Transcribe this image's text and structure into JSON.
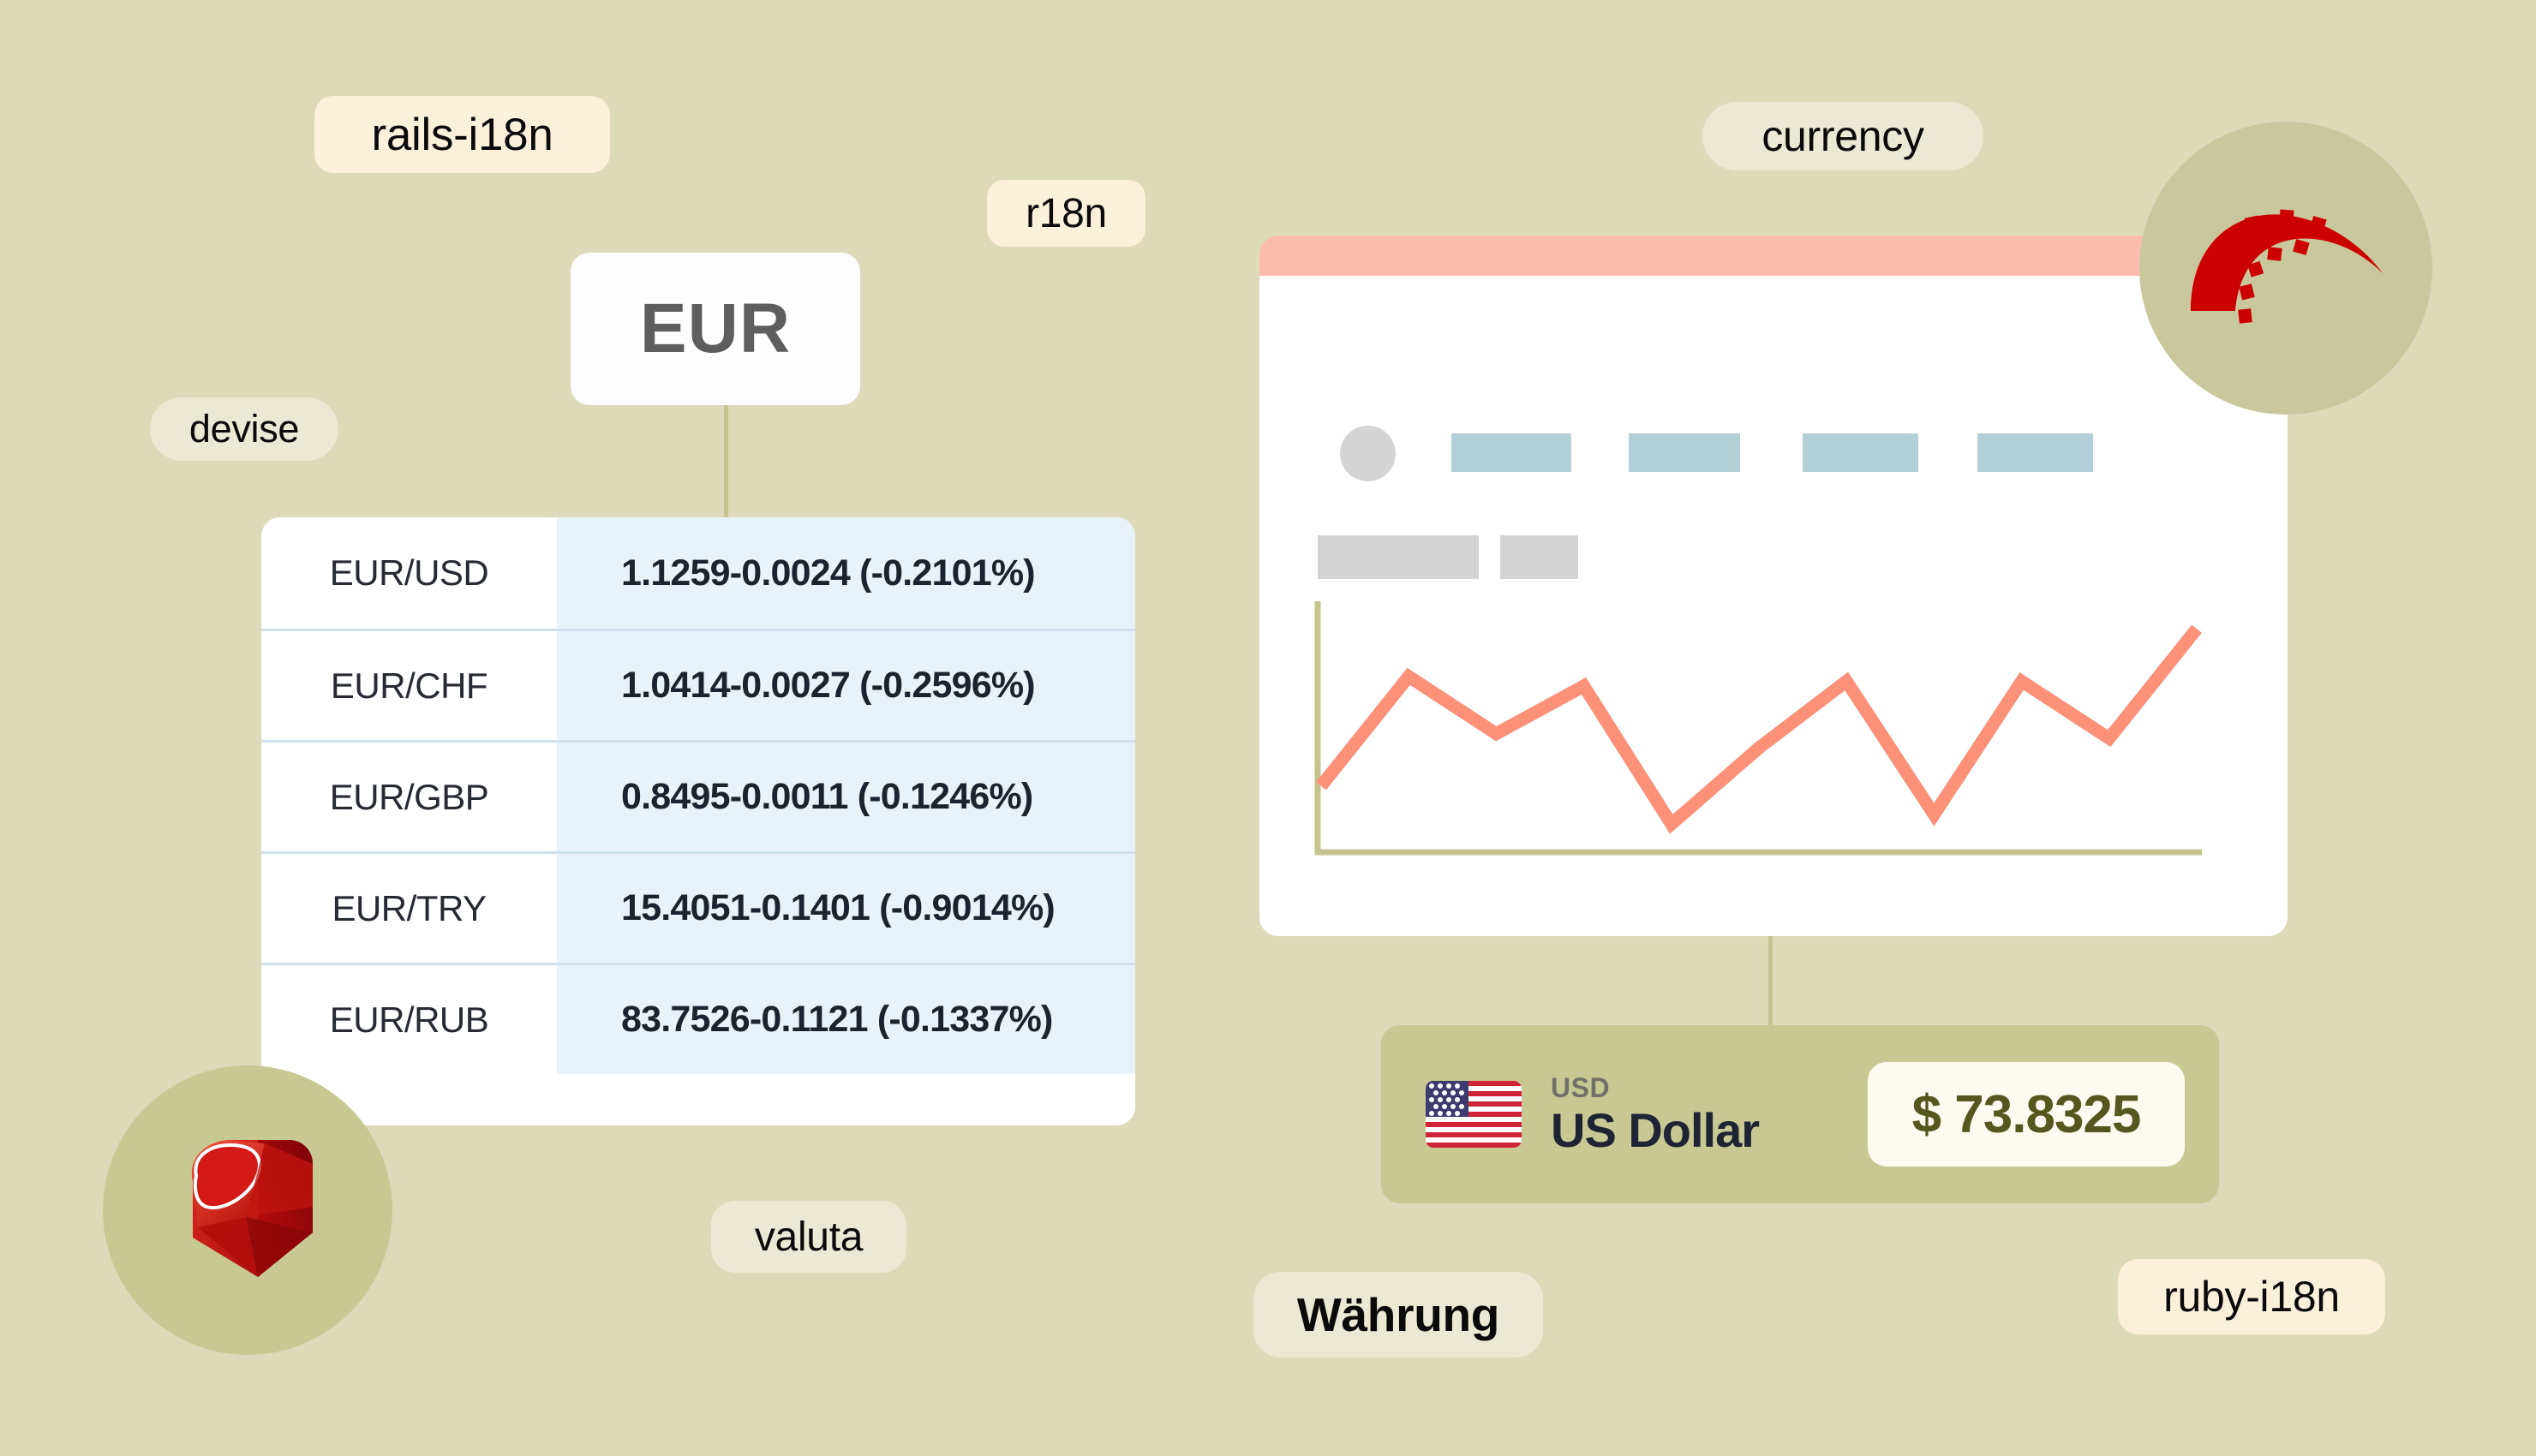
{
  "canvas": {
    "background_color": "#dcdab8"
  },
  "tags": [
    {
      "id": "rails-i18n",
      "label": "rails-i18n"
    },
    {
      "id": "r18n",
      "label": "r18n"
    },
    {
      "id": "devise",
      "label": "devise"
    },
    {
      "id": "valuta",
      "label": "valuta"
    },
    {
      "id": "currency",
      "label": "currency"
    },
    {
      "id": "wahrung",
      "label": "Währung"
    },
    {
      "id": "ruby-i18n",
      "label": "ruby-i18n"
    }
  ],
  "base_currency": {
    "code": "EUR"
  },
  "rates_table": {
    "columns": [
      "pair",
      "quote"
    ],
    "rows": [
      {
        "pair": "EUR/USD",
        "quote": "1.1259-0.0024 (-0.2101%)",
        "rate": 1.1259,
        "change": -0.0024,
        "change_pct": -0.2101
      },
      {
        "pair": "EUR/CHF",
        "quote": "1.0414-0.0027 (-0.2596%)",
        "rate": 1.0414,
        "change": -0.0027,
        "change_pct": -0.2596
      },
      {
        "pair": "EUR/GBP",
        "quote": "0.8495-0.0011 (-0.1246%)",
        "rate": 0.8495,
        "change": -0.0011,
        "change_pct": -0.1246
      },
      {
        "pair": "EUR/TRY",
        "quote": "15.4051-0.1401 (-0.9014%)",
        "rate": 15.4051,
        "change": -0.1401,
        "change_pct": -0.9014
      },
      {
        "pair": "EUR/RUB",
        "quote": "83.7526-0.1121 (-0.1337%)",
        "rate": 83.7526,
        "change": -0.1121,
        "change_pct": -0.1337
      }
    ]
  },
  "browser_mock": {
    "titlebar_color": "#fdbcab",
    "avatar": "avatar-circle",
    "nav_blocks": 4,
    "nav_block_color": "#b3d0d9",
    "placeholder_blocks": 2,
    "placeholder_block_color": "#d3d3d3"
  },
  "chart_data": {
    "type": "line",
    "title": "",
    "xlabel": "",
    "ylabel": "",
    "grid": false,
    "legend": "none",
    "line_color": "#fb9179",
    "axis_color": "#c5c48e",
    "x": [
      0,
      1,
      2,
      3,
      4,
      5,
      6,
      7,
      8,
      9,
      10
    ],
    "values": [
      26,
      72,
      48,
      68,
      10,
      42,
      70,
      14,
      70,
      46,
      92
    ],
    "ylim": [
      0,
      100
    ],
    "xlim": [
      0,
      10
    ]
  },
  "currency_card": {
    "code": "USD",
    "name": "US Dollar",
    "value": "$ 73.8325",
    "amount": 73.8325,
    "symbol": "$",
    "flag": "us-flag-icon",
    "card_color": "#c8c893",
    "value_box_color": "#fdfbef",
    "value_text_color": "#55571f"
  },
  "logos": {
    "ruby": {
      "name": "ruby-gem-logo",
      "badge_color": "#c8c893",
      "accent": "#c70000"
    },
    "rails": {
      "name": "rails-logo",
      "badge_color": "#c9c89c",
      "accent": "#cc0000"
    }
  }
}
